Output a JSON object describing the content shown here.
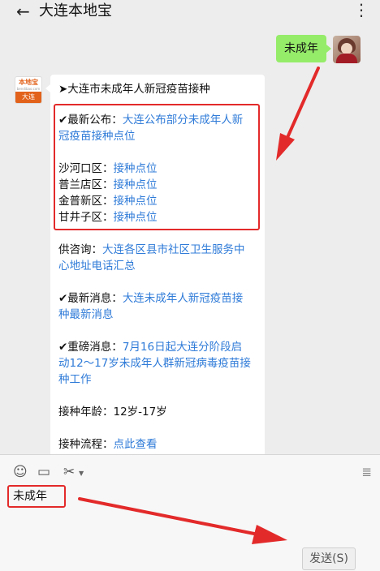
{
  "header": {
    "back_icon": "←",
    "title": "大连本地宝",
    "more_icon": "⋮"
  },
  "chat": {
    "my_message": "未成年",
    "bot_avatar": {
      "top": "本地宝",
      "mid": "bendibao.com",
      "bottom": "大连"
    },
    "bot_lines": [
      {
        "prefix": "➤大连市未成年人新冠疫苗接种",
        "link": ""
      },
      {
        "prefix": "✔最新公布：",
        "link": "大连公布部分未成年人新"
      },
      {
        "prefix": "",
        "link": "冠疫苗接种点位"
      },
      {
        "prefix": "沙河口区：",
        "link": "接种点位"
      },
      {
        "prefix": "普兰店区：",
        "link": "接种点位"
      },
      {
        "prefix": "金普新区：",
        "link": "接种点位"
      },
      {
        "prefix": "甘井子区：",
        "link": "接种点位"
      },
      {
        "prefix": "供咨询：",
        "link": "大连各区县市社区卫生服务中"
      },
      {
        "prefix": "",
        "link": "心地址电话汇总"
      },
      {
        "prefix": "✔最新消息：",
        "link": "大连未成年人新冠疫苗接"
      },
      {
        "prefix": "",
        "link": "种最新消息"
      },
      {
        "prefix": "✔重磅消息：",
        "link": "7月16日起大连分阶段启"
      },
      {
        "prefix": "",
        "link": "动12～17岁未成年人群新冠病毒疫苗接"
      },
      {
        "prefix": "",
        "link": "种工作"
      },
      {
        "prefix": "接种年龄：12岁-17岁",
        "link": ""
      },
      {
        "prefix": "接种流程：",
        "link": "点此查看"
      }
    ]
  },
  "composer": {
    "emoji_icon": "☺",
    "folder_icon": "▭",
    "scissors_icon": "✂",
    "history_icon": "≣",
    "input_value": "未成年",
    "send_label": "发送(S)"
  },
  "colors": {
    "accent_green": "#95ec69",
    "link_blue": "#2f7bd8",
    "highlight_red": "#e32a2a"
  }
}
